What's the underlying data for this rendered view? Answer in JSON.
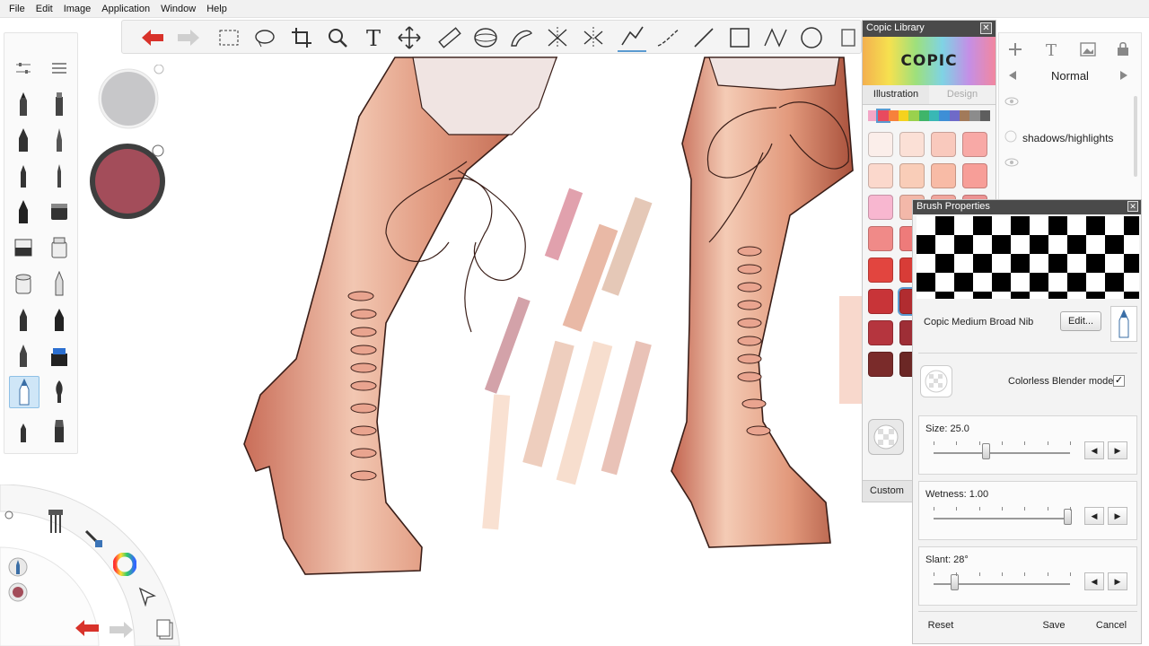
{
  "menu": [
    "File",
    "Edit",
    "Image",
    "Application",
    "Window",
    "Help"
  ],
  "toolbar": {
    "tools": [
      "undo-icon",
      "redo-icon",
      "rect-select-icon",
      "lasso-icon",
      "crop-icon",
      "zoom-icon",
      "text-icon",
      "move-icon",
      "ruler-icon",
      "ellipse-guide-icon",
      "french-curve-icon",
      "symmetry-icon",
      "symmetry-y-icon",
      "stroke-line-icon",
      "curve-icon",
      "line-icon",
      "rectangle-icon",
      "polyline-icon",
      "circle-icon"
    ]
  },
  "copic_library": {
    "title": "Copic Library",
    "logo": "COPIC",
    "tab_active": "Illustration",
    "tab_inactive": "Design",
    "custom_label": "Custom",
    "swatch_colors": [
      [
        "#fbeeea",
        "#fbe0d6",
        "#f9c9bd",
        "#f8a9a6"
      ],
      [
        "#fbd8cc",
        "#f9cdb8",
        "#f8bba6",
        "#f79e98"
      ],
      [
        "#f8b7d0",
        "#f3b8a9",
        "#f1a69d",
        "#ec9292"
      ],
      [
        "#f08a88",
        "#ee7b7a",
        "#e56a6a",
        "#dd5f5f"
      ],
      [
        "#e2453f",
        "#d83c37",
        "#cf3532",
        "#c3302e"
      ],
      [
        "#c83438",
        "#b12c30",
        "#a0282c",
        "#8a2426"
      ],
      [
        "#b5353e",
        "#9e2e36",
        "#8c2a31",
        "#77242a"
      ],
      [
        "#7a2b2a",
        "#6b2725",
        "#5c2220",
        "#4f1e1c"
      ]
    ]
  },
  "layers": {
    "blend_mode": "Normal",
    "layer_names": [
      "",
      "shadows/highlights",
      ""
    ]
  },
  "brush": {
    "title": "Brush Properties",
    "name": "Copic Medium Broad Nib",
    "edit_label": "Edit...",
    "colorless_label": "Colorless Blender mode",
    "colorless_checked": "✓",
    "size_label": "Size: 25.0",
    "size_value": 25.0,
    "wetness_label": "Wetness: 1.00",
    "wetness_value": 1.0,
    "slant_label": "Slant: 28°",
    "slant_value": 28,
    "reset_label": "Reset",
    "save_label": "Save",
    "cancel_label": "Cancel"
  },
  "colors": {
    "puck_top": "#c7c7c9",
    "puck_current": "#a34d5a",
    "accent": "#5a9ad0",
    "undo_red": "#d8322a"
  }
}
